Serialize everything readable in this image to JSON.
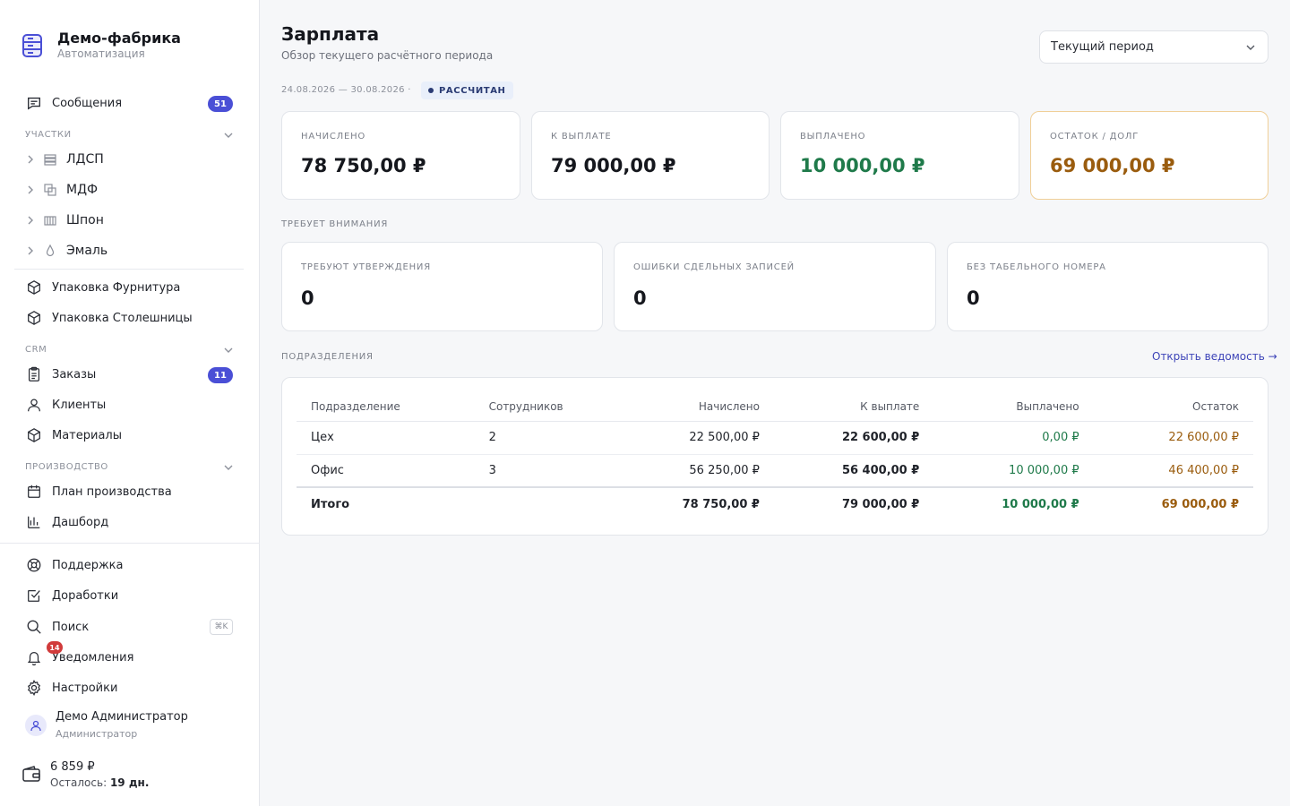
{
  "brand": {
    "title": "Демо-фабрика",
    "subtitle": "Автоматизация"
  },
  "sidebar": {
    "messages": {
      "label": "Сообщения",
      "count": "51"
    },
    "sections": {
      "areas": "УЧАСТКИ",
      "crm": "CRM",
      "production": "ПРОИЗВОДСТВО"
    },
    "areas": [
      {
        "label": "ЛДСП"
      },
      {
        "label": "МДФ"
      },
      {
        "label": "Шпон"
      },
      {
        "label": "Эмаль"
      }
    ],
    "packaging": [
      {
        "label": "Упаковка Фурнитура"
      },
      {
        "label": "Упаковка Столешницы"
      }
    ],
    "crm": {
      "orders": {
        "label": "Заказы",
        "count": "11"
      },
      "clients": "Клиенты",
      "materials": "Материалы"
    },
    "production": {
      "plan": "План производства",
      "dashboard": "Дашборд"
    },
    "bottom": {
      "support": "Поддержка",
      "improvements": "Доработки",
      "search": "Поиск",
      "search_kbd": "⌘K",
      "notifications": "Уведомления",
      "notifications_count": "14",
      "settings": "Настройки"
    },
    "user": {
      "name": "Демо Администратор",
      "role": "Администратор"
    },
    "wallet": {
      "amount": "6 859 ₽",
      "left_label": "Осталось:",
      "left_value": "19 дн."
    }
  },
  "header": {
    "title": "Зарплата",
    "subtitle": "Обзор текущего расчётного периода",
    "period_select": "Текущий период",
    "date_range": "24.08.2026 — 30.08.2026 ·",
    "status": "РАССЧИТАН"
  },
  "summary": [
    {
      "label": "НАЧИСЛЕНО",
      "value": "78 750,00 ₽"
    },
    {
      "label": "К ВЫПЛАТЕ",
      "value": "79 000,00 ₽"
    },
    {
      "label": "ВЫПЛАЧЕНО",
      "value": "10 000,00 ₽"
    },
    {
      "label": "ОСТАТОК / ДОЛГ",
      "value": "69 000,00 ₽"
    }
  ],
  "attention": {
    "title": "ТРЕБУЕТ ВНИМАНИЯ",
    "cards": [
      {
        "label": "ТРЕБУЮТ УТВЕРЖДЕНИЯ",
        "value": "0"
      },
      {
        "label": "ОШИБКИ СДЕЛЬНЫХ ЗАПИСЕЙ",
        "value": "0"
      },
      {
        "label": "БЕЗ ТАБЕЛЬНОГО НОМЕРА",
        "value": "0"
      }
    ]
  },
  "departments": {
    "title": "ПОДРАЗДЕЛЕНИЯ",
    "link": "Открыть ведомость →",
    "columns": [
      "Подразделение",
      "Сотрудников",
      "Начислено",
      "К выплате",
      "Выплачено",
      "Остаток"
    ],
    "rows": [
      {
        "name": "Цех",
        "employees": "2",
        "accrued": "22 500,00 ₽",
        "to_pay": "22 600,00 ₽",
        "paid": "0,00 ₽",
        "balance": "22 600,00 ₽"
      },
      {
        "name": "Офис",
        "employees": "3",
        "accrued": "56 250,00 ₽",
        "to_pay": "56 400,00 ₽",
        "paid": "10 000,00 ₽",
        "balance": "46 400,00 ₽"
      }
    ],
    "total": {
      "name": "Итого",
      "employees": "",
      "accrued": "78 750,00 ₽",
      "to_pay": "79 000,00 ₽",
      "paid": "10 000,00 ₽",
      "balance": "69 000,00 ₽"
    }
  }
}
